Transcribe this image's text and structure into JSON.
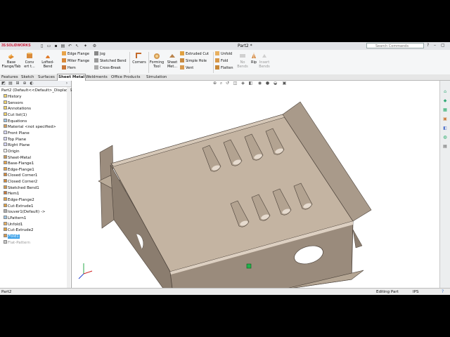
{
  "app": {
    "brand": "SOLIDWORKS",
    "document_title": "Part2 *",
    "search_placeholder": "Search Commands"
  },
  "command_manager": {
    "large_buttons": [
      {
        "key": "base_flange",
        "label_line1": "Base",
        "label_line2": "Flange/Tab",
        "icon": "base-flange-icon"
      },
      {
        "key": "convert",
        "label_line1": "Conv",
        "label_line2": "ert t...",
        "icon": "convert-to-sheet-metal-icon"
      },
      {
        "key": "lofted_bend",
        "label_line1": "Lofted-Bend",
        "label_line2": "",
        "icon": "lofted-bend-icon"
      },
      {
        "key": "corners",
        "label_line1": "Corners",
        "label_line2": "",
        "icon": "corners-icon"
      },
      {
        "key": "forming_tool",
        "label_line1": "Forming",
        "label_line2": "Tool",
        "icon": "forming-tool-icon"
      },
      {
        "key": "sheet_metal",
        "label_line1": "Sheet",
        "label_line2": "Met...",
        "icon": "sheet-metal-icon"
      },
      {
        "key": "no_bends",
        "label_line1": "No",
        "label_line2": "Bends",
        "icon": "no-bends-icon",
        "disabled": true
      },
      {
        "key": "rip",
        "label_line1": "Rip",
        "label_line2": "",
        "icon": "rip-icon"
      },
      {
        "key": "insert_bends",
        "label_line1": "Insert",
        "label_line2": "Bends",
        "icon": "insert-bends-icon",
        "disabled": true
      }
    ],
    "small_buttons": {
      "edge_flange": "Edge Flange",
      "miter_flange": "Miter Flange",
      "hem": "Hem",
      "jog": "Jog",
      "sketched_bend": "Sketched Bend",
      "cross_break": "Cross-Break",
      "extruded_cut": "Extruded Cut",
      "simple_hole": "Simple Hole",
      "vent": "Vent",
      "unfold": "Unfold",
      "fold": "Fold",
      "flatten": "Flatten"
    }
  },
  "tabs": [
    "Features",
    "Sketch",
    "Surfaces",
    "Sheet Metal",
    "Weldments",
    "Office Products",
    "Simulation"
  ],
  "active_tab": "Sheet Metal",
  "feature_tree": {
    "root": "Part2  (Default<<Default>_Display S",
    "items": [
      {
        "label": "History",
        "icon": "history-icon"
      },
      {
        "label": "Sensors",
        "icon": "sensors-icon"
      },
      {
        "label": "Annotations",
        "icon": "annotations-icon"
      },
      {
        "label": "Cut list(1)",
        "icon": "cut-list-icon"
      },
      {
        "label": "Equations",
        "icon": "equations-icon"
      },
      {
        "label": "Material <not specified>",
        "icon": "material-icon"
      },
      {
        "label": "Front Plane",
        "icon": "plane-icon"
      },
      {
        "label": "Top Plane",
        "icon": "plane-icon"
      },
      {
        "label": "Right Plane",
        "icon": "plane-icon"
      },
      {
        "label": "Origin",
        "icon": "origin-icon"
      },
      {
        "label": "Sheet-Metal",
        "icon": "sheet-metal-icon"
      },
      {
        "label": "Base-Flange1",
        "icon": "base-flange-icon"
      },
      {
        "label": "Edge-Flange1",
        "icon": "edge-flange-icon"
      },
      {
        "label": "Closed Corner1",
        "icon": "closed-corner-icon"
      },
      {
        "label": "Closed Corner2",
        "icon": "closed-corner-icon"
      },
      {
        "label": "Sketched Bend1",
        "icon": "sketched-bend-icon"
      },
      {
        "label": "Hem1",
        "icon": "hem-icon"
      },
      {
        "label": "Edge-Flange2",
        "icon": "edge-flange-icon"
      },
      {
        "label": "Cut-Extrude1",
        "icon": "cut-extrude-icon"
      },
      {
        "label": "louver1(Default) ->",
        "icon": "louver-icon"
      },
      {
        "label": "LPattern1",
        "icon": "linear-pattern-icon"
      },
      {
        "label": "Unfold1",
        "icon": "unfold-icon"
      },
      {
        "label": "Cut-Extrude2",
        "icon": "cut-extrude-icon"
      },
      {
        "label": "Fold1",
        "icon": "fold-icon",
        "selected": true
      },
      {
        "label": "Flat-Pattern",
        "icon": "flat-pattern-icon",
        "dim": true
      }
    ]
  },
  "status_bar": {
    "left": "Part2",
    "mode": "Editing Part",
    "units": "IPS"
  },
  "colors": {
    "part_face_light": "#c9b9a6",
    "part_face_mid": "#a89888",
    "part_face_dark": "#8b7d6f",
    "selection": "#3aa0e8",
    "accent_red": "#c8102e"
  }
}
